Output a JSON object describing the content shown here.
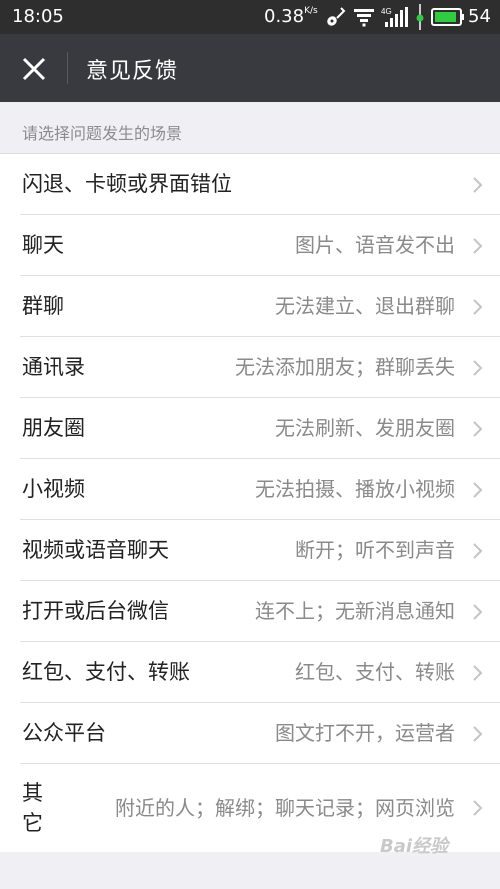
{
  "status_bar": {
    "time": "18:05",
    "net_speed": "0.38",
    "net_unit": "K/s",
    "battery_percent": "54",
    "battery_color": "#2ecc40"
  },
  "header": {
    "title": "意见反馈",
    "close_icon": "close-icon"
  },
  "section": {
    "label": "请选择问题发生的场景"
  },
  "items": [
    {
      "title": "闪退、卡顿或界面错位",
      "desc": ""
    },
    {
      "title": "聊天",
      "desc": "图片、语音发不出"
    },
    {
      "title": "群聊",
      "desc": "无法建立、退出群聊"
    },
    {
      "title": "通讯录",
      "desc": "无法添加朋友；群聊丢失"
    },
    {
      "title": "朋友圈",
      "desc": "无法刷新、发朋友圈"
    },
    {
      "title": "小视频",
      "desc": "无法拍摄、播放小视频"
    },
    {
      "title": "视频或语音聊天",
      "desc": "断开；听不到声音"
    },
    {
      "title": "打开或后台微信",
      "desc": "连不上；无新消息通知"
    },
    {
      "title": "红包、支付、转账",
      "desc": "红包、支付、转账"
    },
    {
      "title": "公众平台",
      "desc": "图文打不开，运营者"
    },
    {
      "title": "其它",
      "desc": "附近的人；解绑；聊天记录；网页浏览"
    }
  ],
  "watermark": "Bai经验"
}
